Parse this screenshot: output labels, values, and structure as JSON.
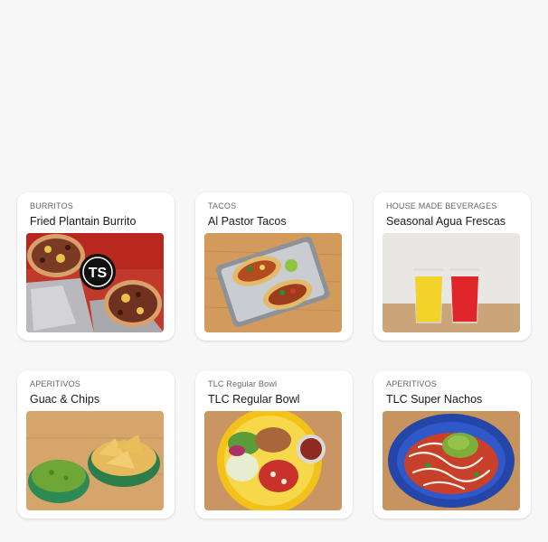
{
  "menu": {
    "items": [
      {
        "category": "BURRITOS",
        "title": "Fried Plantain Burrito",
        "image": "burrito-photo",
        "logo_text": "TS"
      },
      {
        "category": "TACOS",
        "title": "Al Pastor Tacos",
        "image": "tacos-photo"
      },
      {
        "category": "HOUSE MADE BEVERAGES",
        "title": "Seasonal Agua Frescas",
        "image": "agua-frescas-photo"
      },
      {
        "category": "APERITIVOS",
        "title": "Guac & Chips",
        "image": "guac-chips-photo"
      },
      {
        "category": "TLC Regular Bowl",
        "title": "TLC Regular Bowl",
        "image": "bowl-photo"
      },
      {
        "category": "APERITIVOS",
        "title": "TLC Super Nachos",
        "image": "nachos-photo"
      }
    ]
  }
}
